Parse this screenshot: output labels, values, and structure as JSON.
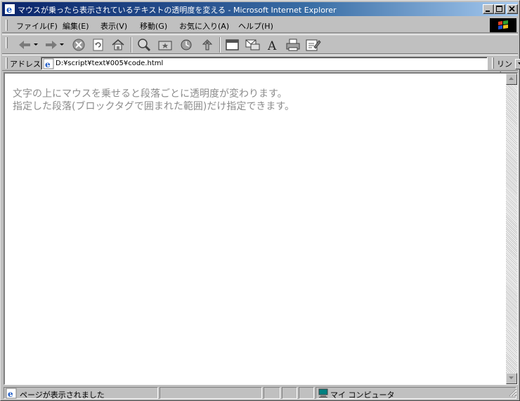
{
  "window": {
    "title": "マウスが乗ったら表示されているテキストの透明度を変える - Microsoft Internet Explorer"
  },
  "menu": {
    "items": [
      "ファイル(F)",
      "編集(E)",
      "表示(V)",
      "移動(G)",
      "お気に入り(A)",
      "ヘルプ(H)"
    ]
  },
  "toolbar": {
    "icons": [
      "back-icon",
      "forward-icon",
      "stop-icon",
      "refresh-icon",
      "home-icon",
      "search-icon",
      "favorites-icon",
      "history-icon",
      "channels-icon",
      "fullscreen-icon",
      "mail-icon",
      "font-icon",
      "print-icon",
      "edit-icon"
    ]
  },
  "address": {
    "label": "アドレス",
    "url": "D:¥script¥text¥005¥code.html",
    "links_label": "リンク"
  },
  "content": {
    "paragraphs": [
      "文字の上にマウスを乗せると段落ごとに透明度が変わります。",
      "指定した段落(ブロックタグで囲まれた範囲)だけ指定できます。"
    ],
    "text_color": "#8c8c8c"
  },
  "status": {
    "message": "ページが表示されました",
    "zone": "マイ コンピュータ"
  },
  "colors": {
    "titlebar_start": "#0a246a",
    "titlebar_end": "#a6caf0",
    "chrome": "#c0c0c0"
  }
}
